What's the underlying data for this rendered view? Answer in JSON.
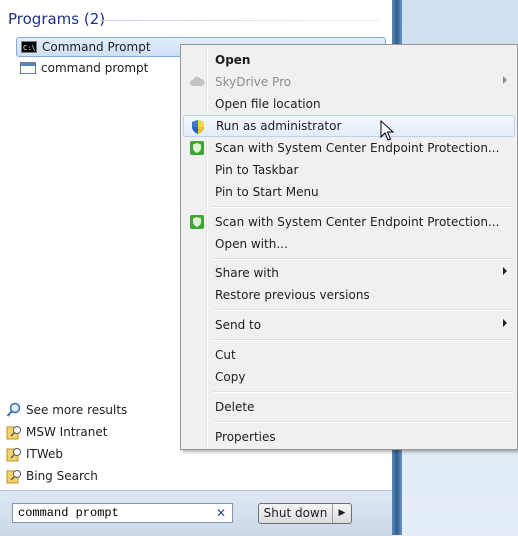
{
  "start_menu": {
    "group_title": "Programs (2)",
    "programs": [
      {
        "label": "Command Prompt",
        "icon": "cmd-icon",
        "selected": true
      },
      {
        "label": "command prompt",
        "icon": "cmd-window-icon",
        "selected": false
      }
    ],
    "links": [
      {
        "label": "See more results",
        "icon": "magnifier-icon"
      },
      {
        "label": "MSW Intranet",
        "icon": "search-connector-icon"
      },
      {
        "label": "ITWeb",
        "icon": "search-connector-icon"
      },
      {
        "label": "Bing Search",
        "icon": "search-connector-icon"
      }
    ],
    "search": {
      "value": "command prompt",
      "clear_glyph": "✕"
    },
    "shutdown": {
      "label": "Shut down",
      "arrow": "▶"
    }
  },
  "context_menu": {
    "items": [
      {
        "label": "Open",
        "bold": true
      },
      {
        "label": "SkyDrive Pro",
        "disabled": true,
        "submenu": true,
        "icon": "cloud-icon"
      },
      {
        "label": "Open file location"
      },
      {
        "label": "Run as administrator",
        "icon": "uac-shield-icon",
        "hover": true
      },
      {
        "label": "Scan with System Center Endpoint Protection...",
        "icon": "endpoint-protection-icon"
      },
      {
        "label": "Pin to Taskbar"
      },
      {
        "label": "Pin to Start Menu"
      },
      {
        "label": "Scan with System Center Endpoint Protection...",
        "icon": "endpoint-protection-icon"
      },
      {
        "label": "Open with..."
      },
      {
        "label": "Share with",
        "submenu": true
      },
      {
        "label": "Restore previous versions"
      },
      {
        "label": "Send to",
        "submenu": true
      },
      {
        "label": "Cut"
      },
      {
        "label": "Copy"
      },
      {
        "label": "Delete"
      },
      {
        "label": "Properties"
      }
    ]
  },
  "colors": {
    "group_title": "#1e3287",
    "hover_border": "#b8d1ef",
    "endpoint_green": "#3fa535"
  }
}
